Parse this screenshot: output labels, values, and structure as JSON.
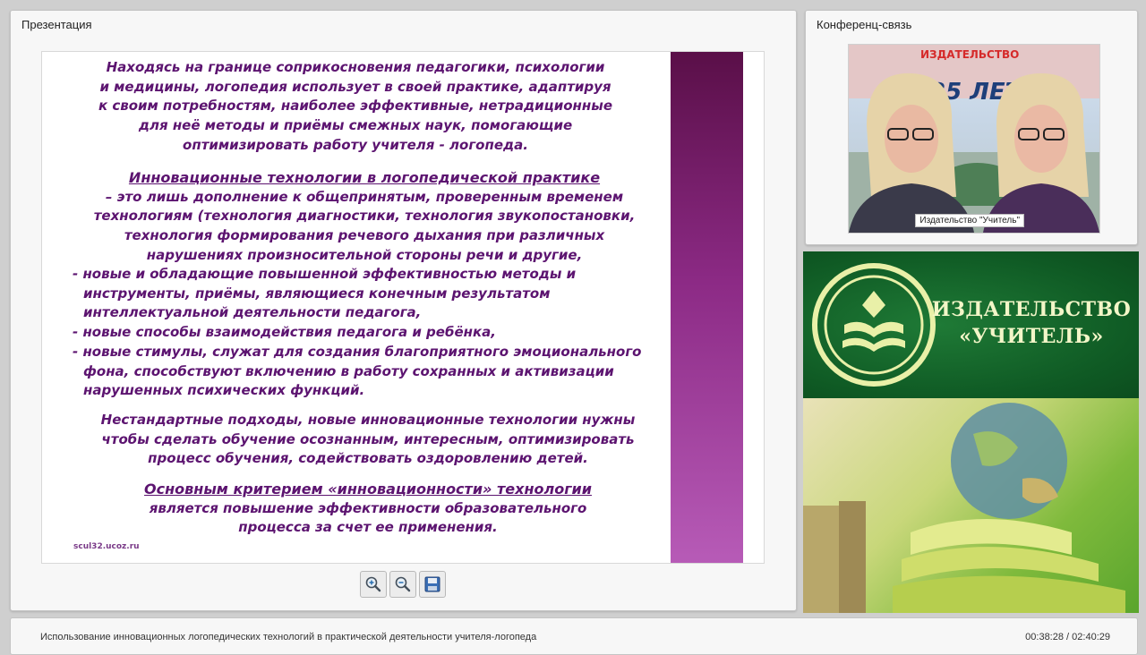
{
  "presentation_panel": {
    "title": "Презентация",
    "slide": {
      "intro_lines": [
        "Находясь на границе соприкосновения педагогики, психологии",
        "и медицины, логопедия использует в своей практике, адаптируя",
        "к своим потребностям, наиболее эффективные, нетрадиционные",
        "для неё методы и приёмы смежных наук, помогающие",
        "оптимизировать работу учителя - логопеда."
      ],
      "heading": "Инновационные технологии в логопедической практике",
      "definition_lines": [
        "– это лишь дополнение к общепринятым, проверенным временем",
        "технологиям (технология диагностики, технология звукопостановки,",
        "технология формирования речевого дыхания при различных",
        "нарушениях произносительной стороны речи и другие,"
      ],
      "list_items": [
        "- новые и обладающие повышенной эффективностью методы и инструменты, приёмы, являющиеся конечным результатом интеллектуальной деятельности педагога,",
        "- новые способы взаимодействия педагога и ребёнка,",
        "- новые стимулы, служат для создания благоприятного эмоционального фона, способствуют включению в работу сохранных и активизации нарушенных психических функций."
      ],
      "approach_lines": [
        "Нестандартные подходы, новые инновационные технологии нужны",
        "чтобы сделать обучение осознанным, интересным, оптимизировать",
        "процесс обучения, содействовать оздоровлению детей."
      ],
      "criterion_heading": "Основным критерием «инновационности» технологии",
      "criterion_lines": [
        "является повышение эффективности образовательного",
        "процесса за счет ее применения."
      ],
      "site": "scul32.ucoz.ru"
    },
    "toolbar": {
      "zoom_in_icon": "zoom-in-icon",
      "zoom_out_icon": "zoom-out-icon",
      "save_icon": "floppy-disk-icon"
    }
  },
  "conference_panel": {
    "title": "Конференц-связь",
    "video": {
      "banner_top": "ИЗДАТЕЛЬСТВО",
      "banner_main": "25 ЛЕТ",
      "caption": "Издательство \"Учитель\""
    }
  },
  "ad_panel": {
    "publisher_line1": "ИЗДАТЕЛЬСТВО",
    "publisher_line2": "«УЧИТЕЛЬ»",
    "logo_icon": "book-logo-icon"
  },
  "footer": {
    "webinar_title": "Использование инновационных логопедических технологий в практической деятельности учителя-логопеда",
    "time_elapsed": "00:38:28",
    "time_separator": "/",
    "time_total": "02:40:29"
  },
  "colors": {
    "slide_text": "#5c1470",
    "ad_green": "#0f5a24"
  }
}
